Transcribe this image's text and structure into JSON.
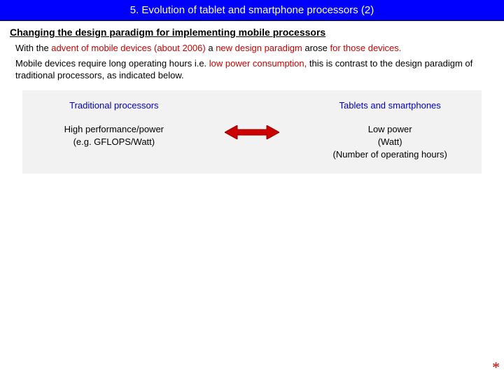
{
  "title": "5. Evolution of tablet and smartphone processors (2)",
  "subtitle": "Changing the design paradigm for implementing mobile processors",
  "para1": {
    "a": "With the ",
    "b": "advent of mobile devices (about 2006)",
    "c": " a ",
    "d": "new design paradigm",
    "e": " arose ",
    "f": "for those devices."
  },
  "para2": {
    "a": "Mobile devices require long operating hours i.e. ",
    "b": "low power consumption,",
    "c": " this is contrast to the design paradigm of traditional processors,  as indicated below."
  },
  "compare": {
    "left": {
      "head": "Traditional processors",
      "l1": "High performance/power",
      "l2": "(e.g. GFLOPS/Watt)"
    },
    "right": {
      "head": "Tablets and smartphones",
      "l1": "Low power",
      "l2": "(Watt)",
      "l3": "(Number of operating hours)"
    }
  },
  "asterisk": "*"
}
